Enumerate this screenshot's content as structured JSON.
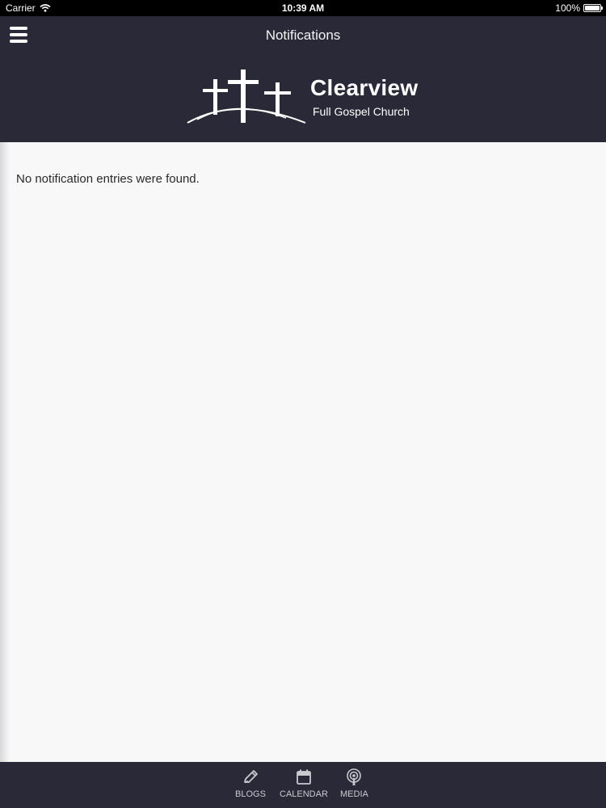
{
  "status_bar": {
    "carrier": "Carrier",
    "time": "10:39 AM",
    "battery": "100%"
  },
  "nav": {
    "title": "Notifications",
    "menu_icon": "hamburger-menu-icon"
  },
  "brand": {
    "name": "Clearview",
    "subtitle": "Full Gospel Church",
    "logo_icon": "three-crosses-icon"
  },
  "content": {
    "empty_message": "No notification entries were found."
  },
  "tabs": [
    {
      "label": "BLOGS",
      "icon": "pencil-icon"
    },
    {
      "label": "CALENDAR",
      "icon": "calendar-icon"
    },
    {
      "label": "MEDIA",
      "icon": "podcast-icon"
    }
  ],
  "colors": {
    "bar_background": "#2a2937",
    "content_background": "#f8f8f9",
    "tab_text": "#c9c9d0"
  }
}
